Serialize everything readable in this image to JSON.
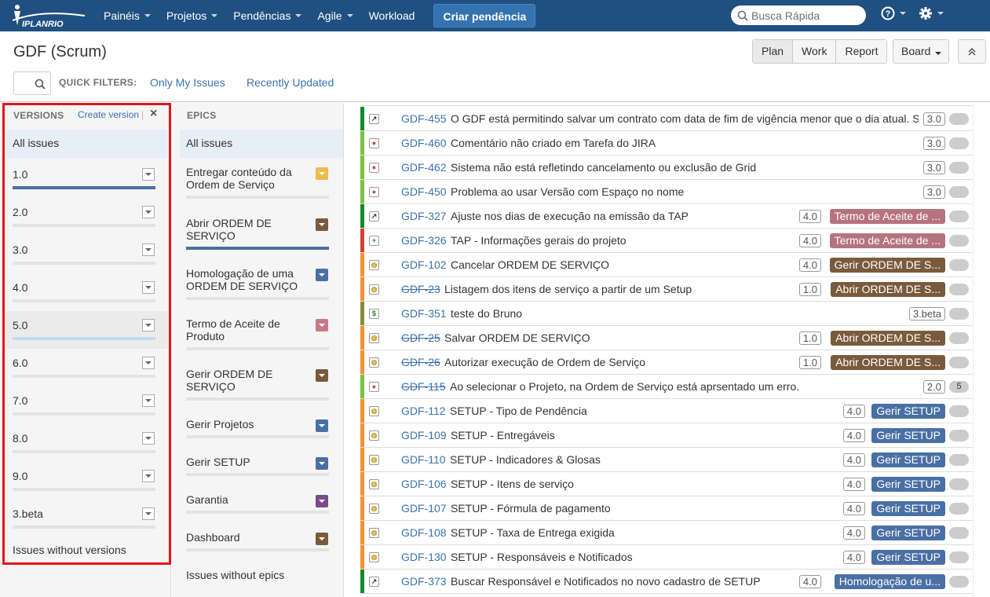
{
  "topnav": {
    "logo_text": "IPLANRIO",
    "items": [
      {
        "label": "Painéis",
        "dropdown": true
      },
      {
        "label": "Projetos",
        "dropdown": true
      },
      {
        "label": "Pendências",
        "dropdown": true
      },
      {
        "label": "Agile",
        "dropdown": true
      },
      {
        "label": "Workload",
        "dropdown": false
      }
    ],
    "create_label": "Criar pendência",
    "search_placeholder": "Busca Rápida",
    "help_icon": "help-icon",
    "settings_icon": "gear-icon"
  },
  "header": {
    "title": "GDF (Scrum)",
    "modes": [
      "Plan",
      "Work",
      "Report"
    ],
    "active_mode": "Plan",
    "board_label": "Board",
    "quick_filters_label": "QUICK FILTERS:",
    "quick_filters": [
      "Only My Issues",
      "Recently Updated"
    ]
  },
  "versions": {
    "title": "VERSIONS",
    "create_label": "Create version",
    "all_label": "All issues",
    "items": [
      {
        "label": "1.0",
        "progress": 1.0
      },
      {
        "label": "2.0",
        "progress": 0
      },
      {
        "label": "3.0",
        "progress": 0
      },
      {
        "label": "4.0",
        "progress": 0
      },
      {
        "label": "5.0",
        "progress": 1.0,
        "selected": true
      },
      {
        "label": "6.0",
        "progress": 0
      },
      {
        "label": "7.0",
        "progress": 0
      },
      {
        "label": "8.0",
        "progress": 0
      },
      {
        "label": "9.0",
        "progress": 0
      },
      {
        "label": "3.beta",
        "progress": 0
      }
    ],
    "none_label": "Issues without versions"
  },
  "epics": {
    "title": "EPICS",
    "all_label": "All issues",
    "items": [
      {
        "label": "Entregar conteúdo da Ordem de Serviço",
        "color": "#f0b94a",
        "progress": 0
      },
      {
        "label": "Abrir ORDEM DE SERVIÇO",
        "color": "#7a5a3c",
        "progress": 1.0
      },
      {
        "label": "Homologação de uma ORDEM DE SERVIÇO",
        "color": "#4a6fa5",
        "progress": 0
      },
      {
        "label": "Termo de Aceite de Produto",
        "color": "#c77a86",
        "progress": 0
      },
      {
        "label": "Gerir ORDEM DE SERVIÇO",
        "color": "#7a5a3c",
        "progress": 0
      },
      {
        "label": "Gerir Projetos",
        "color": "#4a6fa5",
        "progress": 0
      },
      {
        "label": "Gerir SETUP",
        "color": "#4a6fa5",
        "progress": 0
      },
      {
        "label": "Garantia",
        "color": "#7a4a8c",
        "progress": 0
      },
      {
        "label": "Dashboard",
        "color": "#7a5a3c",
        "progress": 0
      }
    ],
    "none_label": "Issues without epics"
  },
  "issues": [
    {
      "key": "GDF-455",
      "summary": "O GDF está permitindo salvar um contrato com data de fim de vigência menor que o dia atual. S",
      "type": "improvement",
      "stripe": "#14892c",
      "version": "3.0",
      "epic": "",
      "epic_color": "",
      "estimate": "",
      "strike": false
    },
    {
      "key": "GDF-460",
      "summary": "Comentário não criado em Tarefa do JIRA",
      "type": "bug",
      "stripe": "#7ac143",
      "version": "3.0",
      "epic": "",
      "epic_color": "",
      "estimate": "",
      "strike": false
    },
    {
      "key": "GDF-462",
      "summary": "Sistema não está refletindo cancelamento ou exclusão de Grid",
      "type": "bug",
      "stripe": "#7ac143",
      "version": "3.0",
      "epic": "",
      "epic_color": "",
      "estimate": "",
      "strike": false
    },
    {
      "key": "GDF-450",
      "summary": "Problema ao usar Versão com Espaço no nome",
      "type": "bug",
      "stripe": "#7ac143",
      "version": "3.0",
      "epic": "",
      "epic_color": "",
      "estimate": "",
      "strike": false
    },
    {
      "key": "GDF-327",
      "summary": "Ajuste nos dias de execução na emissão da TAP",
      "type": "improvement",
      "stripe": "#14892c",
      "version": "4.0",
      "epic": "Termo de Aceite de ...",
      "epic_color": "#b5737d",
      "estimate": "",
      "strike": false
    },
    {
      "key": "GDF-326",
      "summary": "TAP - Informações gerais do projeto",
      "type": "new-feature",
      "stripe": "#d04437",
      "version": "4.0",
      "epic": "Termo de Aceite de ...",
      "epic_color": "#b5737d",
      "estimate": "",
      "strike": false
    },
    {
      "key": "GDF-102",
      "summary": "Cancelar ORDEM DE SERVIÇO",
      "type": "story",
      "stripe": "#f79232",
      "version": "4.0",
      "epic": "Gerir ORDEM DE S...",
      "epic_color": "#7a5a3c",
      "estimate": "",
      "strike": false
    },
    {
      "key": "GDF-23",
      "summary": "Listagem dos itens de serviço a partir de um Setup",
      "type": "story",
      "stripe": "#f79232",
      "version": "1.0",
      "epic": "Abrir ORDEM DE S...",
      "epic_color": "#7a5a3c",
      "estimate": "",
      "strike": true
    },
    {
      "key": "GDF-351",
      "summary": "teste do Bruno",
      "type": "cost",
      "stripe": "#8a8a3c",
      "version": "3.beta",
      "epic": "",
      "epic_color": "",
      "estimate": "",
      "strike": false
    },
    {
      "key": "GDF-25",
      "summary": "Salvar ORDEM DE SERVIÇO",
      "type": "story",
      "stripe": "#f79232",
      "version": "1.0",
      "epic": "Abrir ORDEM DE S...",
      "epic_color": "#7a5a3c",
      "estimate": "",
      "strike": true
    },
    {
      "key": "GDF-26",
      "summary": "Autorizar execução de Ordem de Serviço",
      "type": "story",
      "stripe": "#f79232",
      "version": "1.0",
      "epic": "Abrir ORDEM DE S...",
      "epic_color": "#7a5a3c",
      "estimate": "",
      "strike": true
    },
    {
      "key": "GDF-115",
      "summary": "Ao selecionar o Projeto, na Ordem de Serviço está aprsentado um erro.",
      "type": "bug",
      "stripe": "#7ac143",
      "version": "2.0",
      "epic": "",
      "epic_color": "",
      "estimate": "5",
      "strike": true
    },
    {
      "key": "GDF-112",
      "summary": "SETUP - Tipo de Pendência",
      "type": "story",
      "stripe": "#f79232",
      "version": "4.0",
      "epic": "Gerir SETUP",
      "epic_color": "#4a6fa5",
      "estimate": "",
      "strike": false
    },
    {
      "key": "GDF-109",
      "summary": "SETUP - Entregáveis",
      "type": "story",
      "stripe": "#f79232",
      "version": "4.0",
      "epic": "Gerir SETUP",
      "epic_color": "#4a6fa5",
      "estimate": "",
      "strike": false
    },
    {
      "key": "GDF-110",
      "summary": "SETUP - Indicadores & Glosas",
      "type": "story",
      "stripe": "#f79232",
      "version": "4.0",
      "epic": "Gerir SETUP",
      "epic_color": "#4a6fa5",
      "estimate": "",
      "strike": false
    },
    {
      "key": "GDF-106",
      "summary": "SETUP - Itens de serviço",
      "type": "story",
      "stripe": "#f79232",
      "version": "4.0",
      "epic": "Gerir SETUP",
      "epic_color": "#4a6fa5",
      "estimate": "",
      "strike": false
    },
    {
      "key": "GDF-107",
      "summary": "SETUP - Fórmula de pagamento",
      "type": "story",
      "stripe": "#f79232",
      "version": "4.0",
      "epic": "Gerir SETUP",
      "epic_color": "#4a6fa5",
      "estimate": "",
      "strike": false
    },
    {
      "key": "GDF-108",
      "summary": "SETUP - Taxa de Entrega exigida",
      "type": "story",
      "stripe": "#f79232",
      "version": "4.0",
      "epic": "Gerir SETUP",
      "epic_color": "#4a6fa5",
      "estimate": "",
      "strike": false
    },
    {
      "key": "GDF-130",
      "summary": "SETUP - Responsáveis e Notificados",
      "type": "story",
      "stripe": "#f79232",
      "version": "4.0",
      "epic": "Gerir SETUP",
      "epic_color": "#4a6fa5",
      "estimate": "",
      "strike": false
    },
    {
      "key": "GDF-373",
      "summary": "Buscar Responsável e Notificados no novo cadastro de SETUP",
      "type": "improvement",
      "stripe": "#14892c",
      "version": "4.0",
      "epic": "Homologação de u...",
      "epic_color": "#4a6fa5",
      "estimate": "",
      "strike": false
    }
  ]
}
